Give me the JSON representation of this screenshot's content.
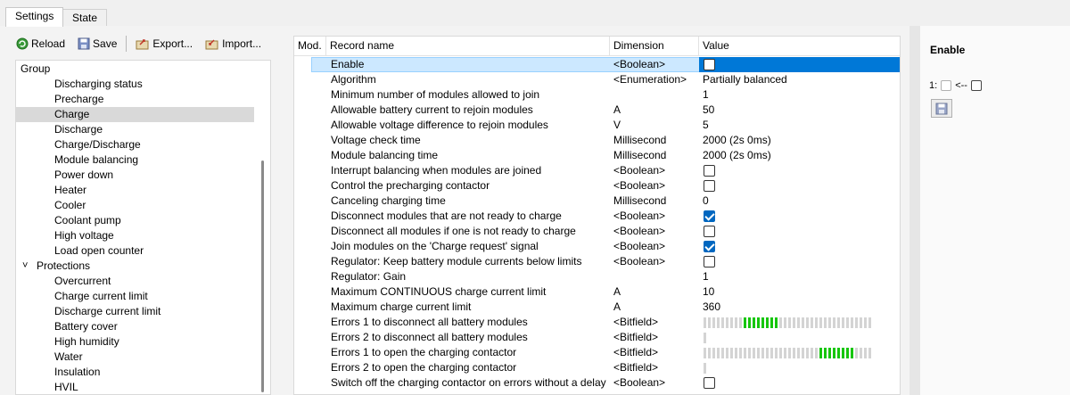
{
  "tabs": [
    "Settings",
    "State"
  ],
  "toolbar": {
    "reload": "Reload",
    "save": "Save",
    "export": "Export...",
    "import": "Import..."
  },
  "group": {
    "header": "Group",
    "items": [
      {
        "label": "Discharging status",
        "indent": 2
      },
      {
        "label": "Precharge",
        "indent": 2
      },
      {
        "label": "Charge",
        "indent": 2,
        "selected": true
      },
      {
        "label": "Discharge",
        "indent": 2
      },
      {
        "label": "Charge/Discharge",
        "indent": 2
      },
      {
        "label": "Module balancing",
        "indent": 2
      },
      {
        "label": "Power down",
        "indent": 2
      },
      {
        "label": "Heater",
        "indent": 2
      },
      {
        "label": "Cooler",
        "indent": 2
      },
      {
        "label": "Coolant pump",
        "indent": 2
      },
      {
        "label": "High voltage",
        "indent": 2
      },
      {
        "label": "Load open counter",
        "indent": 2
      },
      {
        "label": "Protections",
        "indent": 1,
        "expander": "˅"
      },
      {
        "label": "Overcurrent",
        "indent": 2
      },
      {
        "label": "Charge current limit",
        "indent": 2
      },
      {
        "label": "Discharge current limit",
        "indent": 2
      },
      {
        "label": "Battery cover",
        "indent": 2
      },
      {
        "label": "High humidity",
        "indent": 2
      },
      {
        "label": "Water",
        "indent": 2
      },
      {
        "label": "Insulation",
        "indent": 2
      },
      {
        "label": "HVIL",
        "indent": 2
      }
    ]
  },
  "table": {
    "headers": {
      "mod": "Mod.",
      "name": "Record name",
      "dimension": "Dimension",
      "value": "Value"
    },
    "rows": [
      {
        "name": "Enable",
        "dimension": "<Boolean>",
        "type": "check",
        "checked": false,
        "selected": true
      },
      {
        "name": "Algorithm",
        "dimension": "<Enumeration>",
        "type": "text",
        "value": "Partially balanced"
      },
      {
        "name": "Minimum number of modules allowed to join",
        "dimension": "",
        "type": "text",
        "value": "1"
      },
      {
        "name": "Allowable battery current to rejoin modules",
        "dimension": "A",
        "type": "text",
        "value": "50"
      },
      {
        "name": "Allowable voltage difference to rejoin modules",
        "dimension": "V",
        "type": "text",
        "value": "5"
      },
      {
        "name": "Voltage check time",
        "dimension": "Millisecond",
        "type": "text",
        "value": "2000 (2s 0ms)"
      },
      {
        "name": "Module balancing time",
        "dimension": "Millisecond",
        "type": "text",
        "value": "2000 (2s 0ms)"
      },
      {
        "name": "Interrupt balancing when modules are joined",
        "dimension": "<Boolean>",
        "type": "check",
        "checked": false
      },
      {
        "name": "Control the precharging contactor",
        "dimension": "<Boolean>",
        "type": "check",
        "checked": false
      },
      {
        "name": "Canceling charging time",
        "dimension": "Millisecond",
        "type": "text",
        "value": "0"
      },
      {
        "name": "Disconnect modules that are not ready to charge",
        "dimension": "<Boolean>",
        "type": "check",
        "checked": true
      },
      {
        "name": "Disconnect all modules if one is not ready to charge",
        "dimension": "<Boolean>",
        "type": "check",
        "checked": false
      },
      {
        "name": "Join modules on the 'Charge request' signal",
        "dimension": "<Boolean>",
        "type": "check",
        "checked": true
      },
      {
        "name": "Regulator: Keep battery module currents below limits",
        "dimension": "<Boolean>",
        "type": "check",
        "checked": false
      },
      {
        "name": "Regulator: Gain",
        "dimension": "",
        "type": "text",
        "value": "1"
      },
      {
        "name": "Maximum CONTINUOUS charge current limit",
        "dimension": "A",
        "type": "text",
        "value": "10"
      },
      {
        "name": "Maximum charge current limit",
        "dimension": "A",
        "type": "text",
        "value": "360"
      },
      {
        "name": "Errors 1 to disconnect all battery modules",
        "dimension": "<Bitfield>",
        "type": "bits",
        "bits": "00000000011111111000000000000000000000"
      },
      {
        "name": "Errors 2 to disconnect all battery modules",
        "dimension": "<Bitfield>",
        "type": "bits",
        "bits": "0"
      },
      {
        "name": "Errors 1 to open the charging contactor",
        "dimension": "<Bitfield>",
        "type": "bits",
        "bits": "00000000000000000000000000111111110000"
      },
      {
        "name": "Errors 2 to open the charging contactor",
        "dimension": "<Bitfield>",
        "type": "bits",
        "bits": "0"
      },
      {
        "name": "Switch off the charging contactor on errors without a delay",
        "dimension": "<Boolean>",
        "type": "check",
        "checked": false
      }
    ]
  },
  "detail": {
    "title": "Enable",
    "bit_label": "1:",
    "arrow": "<--"
  },
  "colors": {
    "accent": "#0078d7",
    "bit_on": "#16c60c",
    "bit_off": "#d4d4d4",
    "selection": "#cce8ff"
  }
}
